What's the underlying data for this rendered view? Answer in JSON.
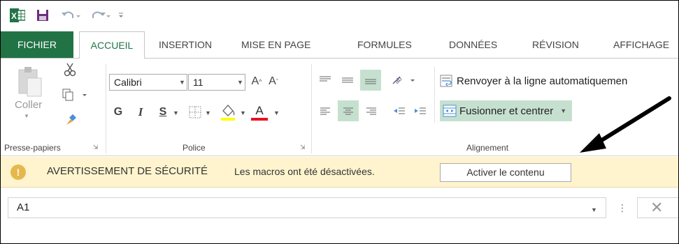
{
  "qat": {
    "icons": [
      "excel-logo-icon",
      "save-icon",
      "undo-icon",
      "redo-icon",
      "customize-qat-icon"
    ]
  },
  "tabs": [
    {
      "label": "FICHIER"
    },
    {
      "label": "ACCUEIL"
    },
    {
      "label": "INSERTION"
    },
    {
      "label": "MISE EN PAGE"
    },
    {
      "label": "FORMULES"
    },
    {
      "label": "DONNÉES"
    },
    {
      "label": "RÉVISION"
    },
    {
      "label": "AFFICHAGE"
    }
  ],
  "ribbon": {
    "clipboard": {
      "paste_label": "Coller",
      "group_label": "Presse-papiers"
    },
    "font": {
      "font_name": "Calibri",
      "font_size": "11",
      "bold": "G",
      "italic": "I",
      "underline": "S",
      "font_color_letter": "A",
      "group_label": "Police"
    },
    "alignment": {
      "wrap_text": "Renvoyer à la ligne automatiquemen",
      "merge_center": "Fusionner et centrer",
      "group_label": "Alignement"
    }
  },
  "security_bar": {
    "title": "AVERTISSEMENT DE SÉCURITÉ",
    "message": "Les macros ont été désactivées.",
    "button": "Activer le contenu",
    "icon_glyph": "!"
  },
  "formula_bar": {
    "name_box": "A1"
  },
  "colors": {
    "excel_green": "#217346",
    "highlight": "#c6e0d0",
    "security_bg": "#fff4ce",
    "font_color_bar": "#e81123",
    "fill_color_bar": "#ffff00"
  }
}
